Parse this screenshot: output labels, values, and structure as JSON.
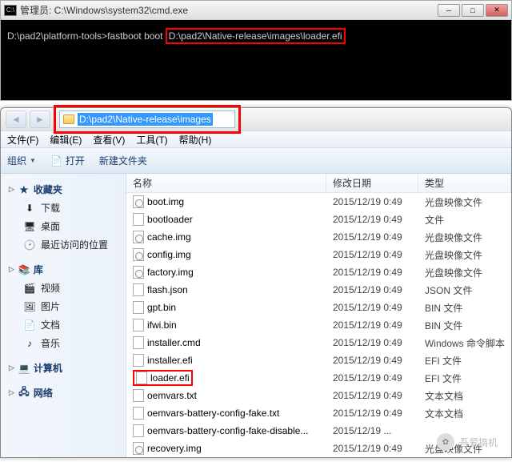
{
  "cmd": {
    "title_prefix": "管理员: ",
    "title_path": "C:\\Windows\\system32\\cmd.exe",
    "prompt": "D:\\pad2\\platform-tools>fastboot boot ",
    "highlighted_arg": "D:\\pad2\\Native-release\\images\\loader.efi"
  },
  "explorer": {
    "address": "D:\\pad2\\Native-release\\images",
    "menus": {
      "file": "文件(F)",
      "edit": "编辑(E)",
      "view": "查看(V)",
      "tools": "工具(T)",
      "help": "帮助(H)"
    },
    "toolbar": {
      "organize": "组织",
      "open": "打开",
      "new_folder": "新建文件夹"
    },
    "sidebar": {
      "favorites": "收藏夹",
      "downloads": "下载",
      "desktop": "桌面",
      "recent": "最近访问的位置",
      "libraries": "库",
      "videos": "视频",
      "pictures": "图片",
      "documents": "文档",
      "music": "音乐",
      "computer": "计算机",
      "network": "网络"
    },
    "columns": {
      "name": "名称",
      "date": "修改日期",
      "type": "类型"
    },
    "files": [
      {
        "name": "boot.img",
        "date": "2015/12/19 0:49",
        "type": "光盘映像文件",
        "icon": "disc"
      },
      {
        "name": "bootloader",
        "date": "2015/12/19 0:49",
        "type": "文件",
        "icon": "file"
      },
      {
        "name": "cache.img",
        "date": "2015/12/19 0:49",
        "type": "光盘映像文件",
        "icon": "disc"
      },
      {
        "name": "config.img",
        "date": "2015/12/19 0:49",
        "type": "光盘映像文件",
        "icon": "disc"
      },
      {
        "name": "factory.img",
        "date": "2015/12/19 0:49",
        "type": "光盘映像文件",
        "icon": "disc"
      },
      {
        "name": "flash.json",
        "date": "2015/12/19 0:49",
        "type": "JSON 文件",
        "icon": "file"
      },
      {
        "name": "gpt.bin",
        "date": "2015/12/19 0:49",
        "type": "BIN 文件",
        "icon": "file"
      },
      {
        "name": "ifwi.bin",
        "date": "2015/12/19 0:49",
        "type": "BIN 文件",
        "icon": "file"
      },
      {
        "name": "installer.cmd",
        "date": "2015/12/19 0:49",
        "type": "Windows 命令脚本",
        "icon": "file"
      },
      {
        "name": "installer.efi",
        "date": "2015/12/19 0:49",
        "type": "EFI 文件",
        "icon": "file"
      },
      {
        "name": "loader.efi",
        "date": "2015/12/19 0:49",
        "type": "EFI 文件",
        "icon": "file",
        "highlight": true
      },
      {
        "name": "oemvars.txt",
        "date": "2015/12/19 0:49",
        "type": "文本文档",
        "icon": "file"
      },
      {
        "name": "oemvars-battery-config-fake.txt",
        "date": "2015/12/19 0:49",
        "type": "文本文档",
        "icon": "file"
      },
      {
        "name": "oemvars-battery-config-fake-disable...",
        "date": "2015/12/19 ...",
        "type": "",
        "icon": "file"
      },
      {
        "name": "recovery.img",
        "date": "2015/12/19 0:49",
        "type": "光盘映像文件",
        "icon": "disc"
      }
    ]
  },
  "watermark": "吾爱搞机"
}
